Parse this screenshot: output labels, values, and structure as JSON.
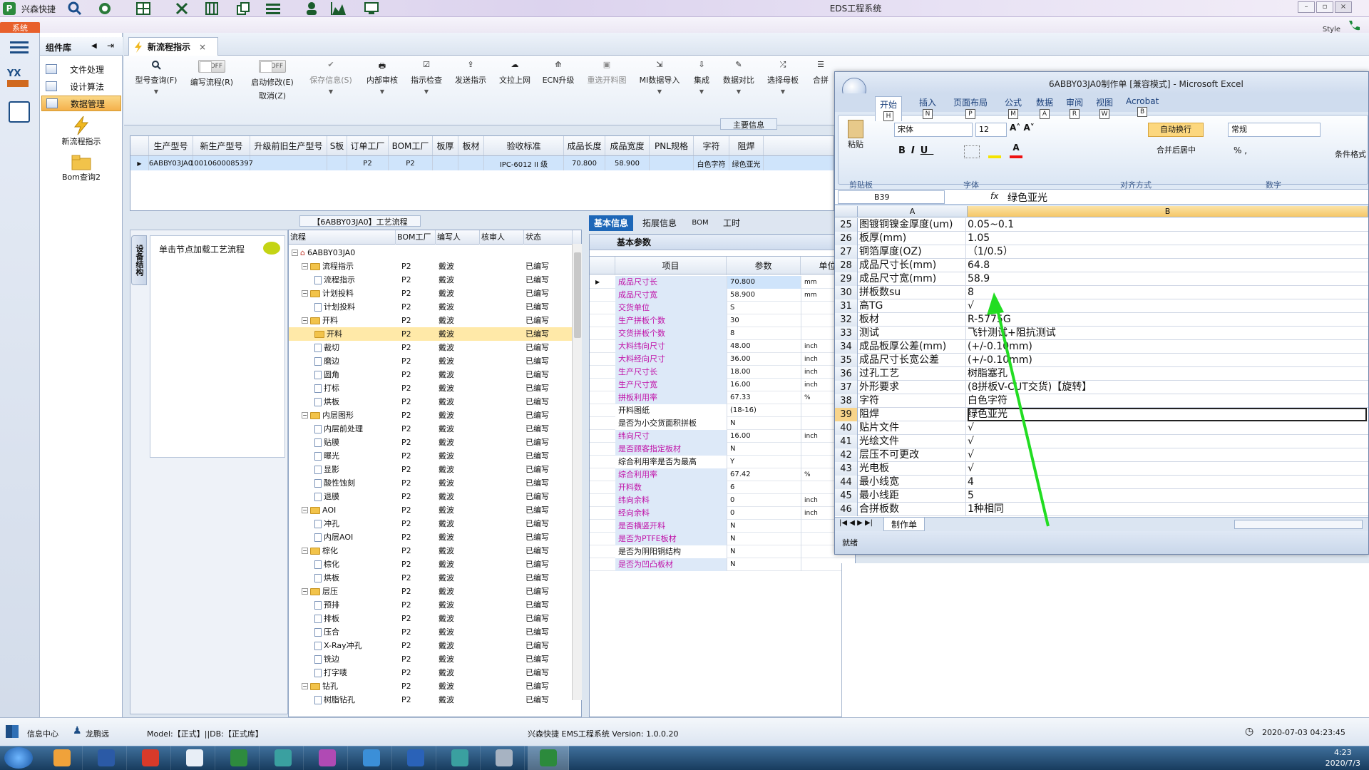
{
  "titlebar": {
    "app_name": "兴森快捷",
    "title": "EDS工程系统"
  },
  "ribbon": {
    "system_tab": "系统",
    "style_label": "Style"
  },
  "component_panel": {
    "title": "组件库",
    "items": [
      {
        "label": "文件处理"
      },
      {
        "label": "设计算法"
      },
      {
        "label": "数据管理"
      }
    ],
    "launch": [
      {
        "label": "新流程指示"
      },
      {
        "label": "Bom查询2"
      }
    ]
  },
  "doc_tab": {
    "label": "新流程指示"
  },
  "toolbar": {
    "model_query": "型号查询(F)",
    "write_flow": "编写流程(R)",
    "start_modify": "启动修改(E)",
    "cancel": "取消(Z)",
    "off": "OFF",
    "save_info": "保存信息(S)",
    "internal_review": "内部审核",
    "instruction_check": "指示检查",
    "send_instruction": "发送指示",
    "bg_upload": "文拉上网",
    "ecn_upgrade": "ECN升级",
    "reselect_image": "重选开料图",
    "mi_import": "MI数据导入",
    "integrate": "集成",
    "data_compare": "数据对比",
    "select_template": "选择母板",
    "merge": "合拼"
  },
  "main_info": {
    "label": "主要信息",
    "columns": [
      "生产型号",
      "新生产型号",
      "升级前旧生产型号",
      "S板",
      "订单工厂",
      "BOM工厂",
      "板厚",
      "板材",
      "验收标准",
      "成品长度",
      "成品宽度",
      "PNL规格",
      "字符",
      "阻焊"
    ],
    "row": [
      "6ABBY03JA0",
      "10010600085397",
      "",
      "",
      "P2",
      "P2",
      "",
      "",
      "IPC-6012 II 级",
      "70.800",
      "58.900",
      "",
      "白色字符",
      "绿色亚光"
    ]
  },
  "process": {
    "title": "【6ABBY03JA0】工艺流程",
    "side_tab": "设备结构",
    "load_node_hint": "单击节点加载工艺流程",
    "columns": [
      "流程",
      "BOM工厂",
      "编写人",
      "核审人",
      "状态"
    ],
    "root": "6ABBY03JA0",
    "rows": [
      {
        "name": "流程指示",
        "level": 1,
        "folder": true,
        "bom": "P2",
        "writer": "戴波",
        "status": "已编写"
      },
      {
        "name": "流程指示",
        "level": 2,
        "folder": false,
        "bom": "P2",
        "writer": "戴波",
        "status": "已编写"
      },
      {
        "name": "计划投料",
        "level": 1,
        "folder": true,
        "bom": "P2",
        "writer": "戴波",
        "status": "已编写"
      },
      {
        "name": "计划投料",
        "level": 2,
        "folder": false,
        "bom": "P2",
        "writer": "戴波",
        "status": "已编写"
      },
      {
        "name": "开料",
        "level": 1,
        "folder": true,
        "bom": "P2",
        "writer": "戴波",
        "status": "已编写"
      },
      {
        "name": "开料",
        "level": 2,
        "folder": true,
        "bom": "P2",
        "writer": "戴波",
        "status": "已编写",
        "selected": true
      },
      {
        "name": "裁切",
        "level": 2,
        "folder": false,
        "bom": "P2",
        "writer": "戴波",
        "status": "已编写"
      },
      {
        "name": "磨边",
        "level": 2,
        "folder": false,
        "bom": "P2",
        "writer": "戴波",
        "status": "已编写"
      },
      {
        "name": "圆角",
        "level": 2,
        "folder": false,
        "bom": "P2",
        "writer": "戴波",
        "status": "已编写"
      },
      {
        "name": "打标",
        "level": 2,
        "folder": false,
        "bom": "P2",
        "writer": "戴波",
        "status": "已编写"
      },
      {
        "name": "烘板",
        "level": 2,
        "folder": false,
        "bom": "P2",
        "writer": "戴波",
        "status": "已编写"
      },
      {
        "name": "内层图形",
        "level": 1,
        "folder": true,
        "bom": "P2",
        "writer": "戴波",
        "status": "已编写"
      },
      {
        "name": "内层前处理",
        "level": 2,
        "folder": false,
        "bom": "P2",
        "writer": "戴波",
        "status": "已编写"
      },
      {
        "name": "贴膜",
        "level": 2,
        "folder": false,
        "bom": "P2",
        "writer": "戴波",
        "status": "已编写"
      },
      {
        "name": "曝光",
        "level": 2,
        "folder": false,
        "bom": "P2",
        "writer": "戴波",
        "status": "已编写"
      },
      {
        "name": "显影",
        "level": 2,
        "folder": false,
        "bom": "P2",
        "writer": "戴波",
        "status": "已编写"
      },
      {
        "name": "酸性蚀刻",
        "level": 2,
        "folder": false,
        "bom": "P2",
        "writer": "戴波",
        "status": "已编写"
      },
      {
        "name": "退膜",
        "level": 2,
        "folder": false,
        "bom": "P2",
        "writer": "戴波",
        "status": "已编写"
      },
      {
        "name": "AOI",
        "level": 1,
        "folder": true,
        "bom": "P2",
        "writer": "戴波",
        "status": "已编写"
      },
      {
        "name": "冲孔",
        "level": 2,
        "folder": false,
        "bom": "P2",
        "writer": "戴波",
        "status": "已编写"
      },
      {
        "name": "内层AOI",
        "level": 2,
        "folder": false,
        "bom": "P2",
        "writer": "戴波",
        "status": "已编写"
      },
      {
        "name": "棕化",
        "level": 1,
        "folder": true,
        "bom": "P2",
        "writer": "戴波",
        "status": "已编写"
      },
      {
        "name": "棕化",
        "level": 2,
        "folder": false,
        "bom": "P2",
        "writer": "戴波",
        "status": "已编写"
      },
      {
        "name": "烘板",
        "level": 2,
        "folder": false,
        "bom": "P2",
        "writer": "戴波",
        "status": "已编写"
      },
      {
        "name": "层压",
        "level": 1,
        "folder": true,
        "bom": "P2",
        "writer": "戴波",
        "status": "已编写"
      },
      {
        "name": "预排",
        "level": 2,
        "folder": false,
        "bom": "P2",
        "writer": "戴波",
        "status": "已编写"
      },
      {
        "name": "排板",
        "level": 2,
        "folder": false,
        "bom": "P2",
        "writer": "戴波",
        "status": "已编写"
      },
      {
        "name": "压合",
        "level": 2,
        "folder": false,
        "bom": "P2",
        "writer": "戴波",
        "status": "已编写"
      },
      {
        "name": "X-Ray冲孔",
        "level": 2,
        "folder": false,
        "bom": "P2",
        "writer": "戴波",
        "status": "已编写"
      },
      {
        "name": "铣边",
        "level": 2,
        "folder": false,
        "bom": "P2",
        "writer": "戴波",
        "status": "已编写"
      },
      {
        "name": "打字唛",
        "level": 2,
        "folder": false,
        "bom": "P2",
        "writer": "戴波",
        "status": "已编写"
      },
      {
        "name": "钻孔",
        "level": 1,
        "folder": true,
        "bom": "P2",
        "writer": "戴波",
        "status": "已编写"
      },
      {
        "name": "树脂钻孔",
        "level": 2,
        "folder": false,
        "bom": "P2",
        "writer": "戴波",
        "status": "已编写"
      }
    ]
  },
  "right_tabs": [
    "基本信息",
    "拓展信息",
    "BOM",
    "工时"
  ],
  "params": {
    "section": "基本参数",
    "columns": [
      "项目",
      "参数",
      "单位"
    ],
    "rows": [
      {
        "k": "成品尺寸长",
        "v": "70.800",
        "u": "mm",
        "hi": true
      },
      {
        "k": "成品尺寸宽",
        "v": "58.900",
        "u": "mm",
        "hi": true
      },
      {
        "k": "交货单位",
        "v": "S",
        "u": "",
        "hi": true
      },
      {
        "k": "生产拼板个数",
        "v": "30",
        "u": "",
        "hi": true
      },
      {
        "k": "交货拼板个数",
        "v": "8",
        "u": "",
        "hi": true
      },
      {
        "k": "大料纬向尺寸",
        "v": "48.00",
        "u": "inch",
        "hi": true
      },
      {
        "k": "大料经向尺寸",
        "v": "36.00",
        "u": "inch",
        "hi": true
      },
      {
        "k": "生产尺寸长",
        "v": "18.00",
        "u": "inch",
        "hi": true
      },
      {
        "k": "生产尺寸宽",
        "v": "16.00",
        "u": "inch",
        "hi": true
      },
      {
        "k": "拼板利用率",
        "v": "67.33",
        "u": "%",
        "hi": true
      },
      {
        "k": "开料图纸",
        "v": "(18-16)",
        "u": "",
        "hi": false
      },
      {
        "k": "是否为小交货面积拼板",
        "v": "N",
        "u": "",
        "hi": false
      },
      {
        "k": "纬向尺寸",
        "v": "16.00",
        "u": "inch",
        "hi": true
      },
      {
        "k": "是否顾客指定板材",
        "v": "N",
        "u": "",
        "hi": true
      },
      {
        "k": "综合利用率是否为最高",
        "v": "Y",
        "u": "",
        "hi": false
      },
      {
        "k": "综合利用率",
        "v": "67.42",
        "u": "%",
        "hi": true
      },
      {
        "k": "开料数",
        "v": "6",
        "u": "",
        "hi": true
      },
      {
        "k": "纬向余料",
        "v": "0",
        "u": "inch",
        "hi": true
      },
      {
        "k": "经向余料",
        "v": "0",
        "u": "inch",
        "hi": true
      },
      {
        "k": "是否横竖开料",
        "v": "N",
        "u": "",
        "hi": true
      },
      {
        "k": "是否为PTFE板材",
        "v": "N",
        "u": "",
        "hi": true
      },
      {
        "k": "是否为阴阳铜结构",
        "v": "N",
        "u": "",
        "hi": false
      },
      {
        "k": "是否为凹凸板材",
        "v": "N",
        "u": "",
        "hi": true
      }
    ]
  },
  "excel": {
    "title": "6ABBY03JA0制作单 [兼容模式] - Microsoft Excel",
    "tabs": [
      {
        "label": "开始",
        "key": "H"
      },
      {
        "label": "插入",
        "key": "N"
      },
      {
        "label": "页面布局",
        "key": "P"
      },
      {
        "label": "公式",
        "key": "M"
      },
      {
        "label": "数据",
        "key": "A"
      },
      {
        "label": "审阅",
        "key": "R"
      },
      {
        "label": "视图",
        "key": "W"
      },
      {
        "label": "Acrobat",
        "key": "B"
      }
    ],
    "ribbon": {
      "paste": "粘贴",
      "font": "宋体",
      "size": "12",
      "wrap": "自动换行",
      "merge": "合并后居中",
      "number_format": "常规",
      "cond_format": "条件格式",
      "groups": [
        "剪贴板",
        "字体",
        "对齐方式",
        "数字"
      ]
    },
    "name_box": "B39",
    "formula": "绿色亚光",
    "col_a": "A",
    "col_b": "B",
    "rows": [
      {
        "n": "25",
        "a": "图镀铜镍金厚度(um)",
        "b": "0.05~0.1"
      },
      {
        "n": "26",
        "a": "板厚(mm)",
        "b": "1.05"
      },
      {
        "n": "27",
        "a": "铜箔厚度(OZ)",
        "b": "（1/0.5）"
      },
      {
        "n": "28",
        "a": "成品尺寸长(mm)",
        "b": "64.8"
      },
      {
        "n": "29",
        "a": "成品尺寸宽(mm)",
        "b": "58.9"
      },
      {
        "n": "30",
        "a": "拼板数su",
        "b": "8"
      },
      {
        "n": "31",
        "a": "高TG",
        "b": "√"
      },
      {
        "n": "32",
        "a": "板材",
        "b": "R-5775G"
      },
      {
        "n": "33",
        "a": "测试",
        "b": "飞针测试+阻抗测试"
      },
      {
        "n": "34",
        "a": "成品板厚公差(mm)",
        "b": "(+/-0.10mm)"
      },
      {
        "n": "35",
        "a": "成品尺寸长宽公差",
        "b": "(+/-0.10mm)"
      },
      {
        "n": "36",
        "a": "过孔工艺",
        "b": "树脂塞孔"
      },
      {
        "n": "37",
        "a": "外形要求",
        "b": "(8拼板V-CUT交货)【旋转】"
      },
      {
        "n": "38",
        "a": "字符",
        "b": "白色字符"
      },
      {
        "n": "39",
        "a": "阻焊",
        "b": "绿色亚光",
        "selected": true
      },
      {
        "n": "40",
        "a": "贴片文件",
        "b": "√"
      },
      {
        "n": "41",
        "a": "光绘文件",
        "b": "√"
      },
      {
        "n": "42",
        "a": "层压不可更改",
        "b": "√"
      },
      {
        "n": "43",
        "a": "光电板",
        "b": "√"
      },
      {
        "n": "44",
        "a": "最小线宽",
        "b": "4"
      },
      {
        "n": "45",
        "a": "最小线距",
        "b": "5"
      },
      {
        "n": "46",
        "a": "合拼板数",
        "b": "1种相同"
      }
    ],
    "sheet": "制作单",
    "status": "就绪"
  },
  "statusbar": {
    "info_center": "信息中心",
    "user": "龙鹏远",
    "model": "Model:【正式】||DB:【正式库】",
    "version": "兴森快捷 EMS工程系统 Version: 1.0.0.20",
    "datetime": "2020-07-03 04:23:45"
  },
  "taskbar": {
    "time": "4:23",
    "date": "2020/7/3"
  },
  "colors": {
    "accent": "#1d67b8",
    "selection": "#ffe9a8",
    "highlight_text": "#c012a8",
    "arrow": "#22dd22"
  }
}
